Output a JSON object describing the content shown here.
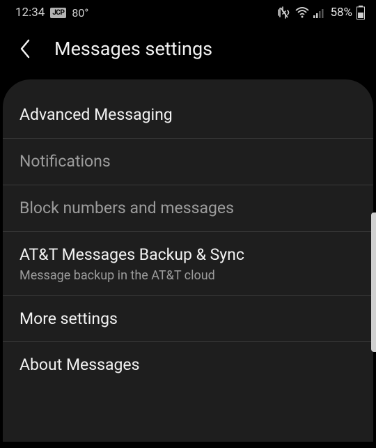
{
  "status_bar": {
    "time": "12:34",
    "badge": "JCP",
    "temp": "80°",
    "battery_pct": "58%"
  },
  "header": {
    "title": "Messages settings"
  },
  "settings": {
    "items": [
      {
        "title": "Advanced Messaging",
        "dimmed": false
      },
      {
        "title": "Notifications",
        "dimmed": true
      },
      {
        "title": "Block numbers and messages",
        "dimmed": true
      },
      {
        "title": "AT&T Messages Backup & Sync",
        "subtitle": "Message backup in the AT&T cloud",
        "dimmed": false
      },
      {
        "title": "More settings",
        "dimmed": false
      },
      {
        "title": "About Messages",
        "dimmed": false
      }
    ]
  }
}
